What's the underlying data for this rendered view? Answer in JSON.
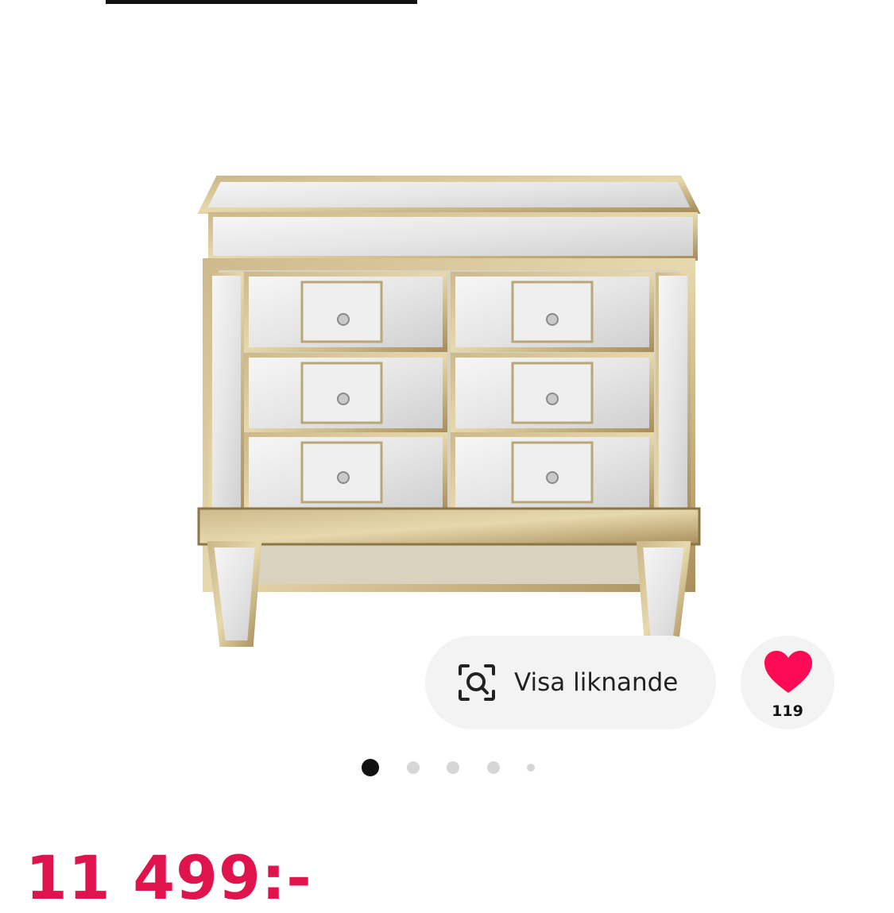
{
  "product": {
    "image_alt": "Spegelbyrå med guldram och sex lådor",
    "price": "11 499:-"
  },
  "actions": {
    "similar_label": "Visa liknande",
    "similar_icon": "visual-search-icon",
    "favorite_icon": "heart-icon",
    "favorite_count": "119"
  },
  "carousel": {
    "total": 5,
    "active_index": 0
  },
  "colors": {
    "accent": "#e0144c",
    "heart": "#ff0a54",
    "button_bg": "#f3f3f3",
    "dot_active": "#111111",
    "dot_inactive": "#d6d6d6"
  }
}
